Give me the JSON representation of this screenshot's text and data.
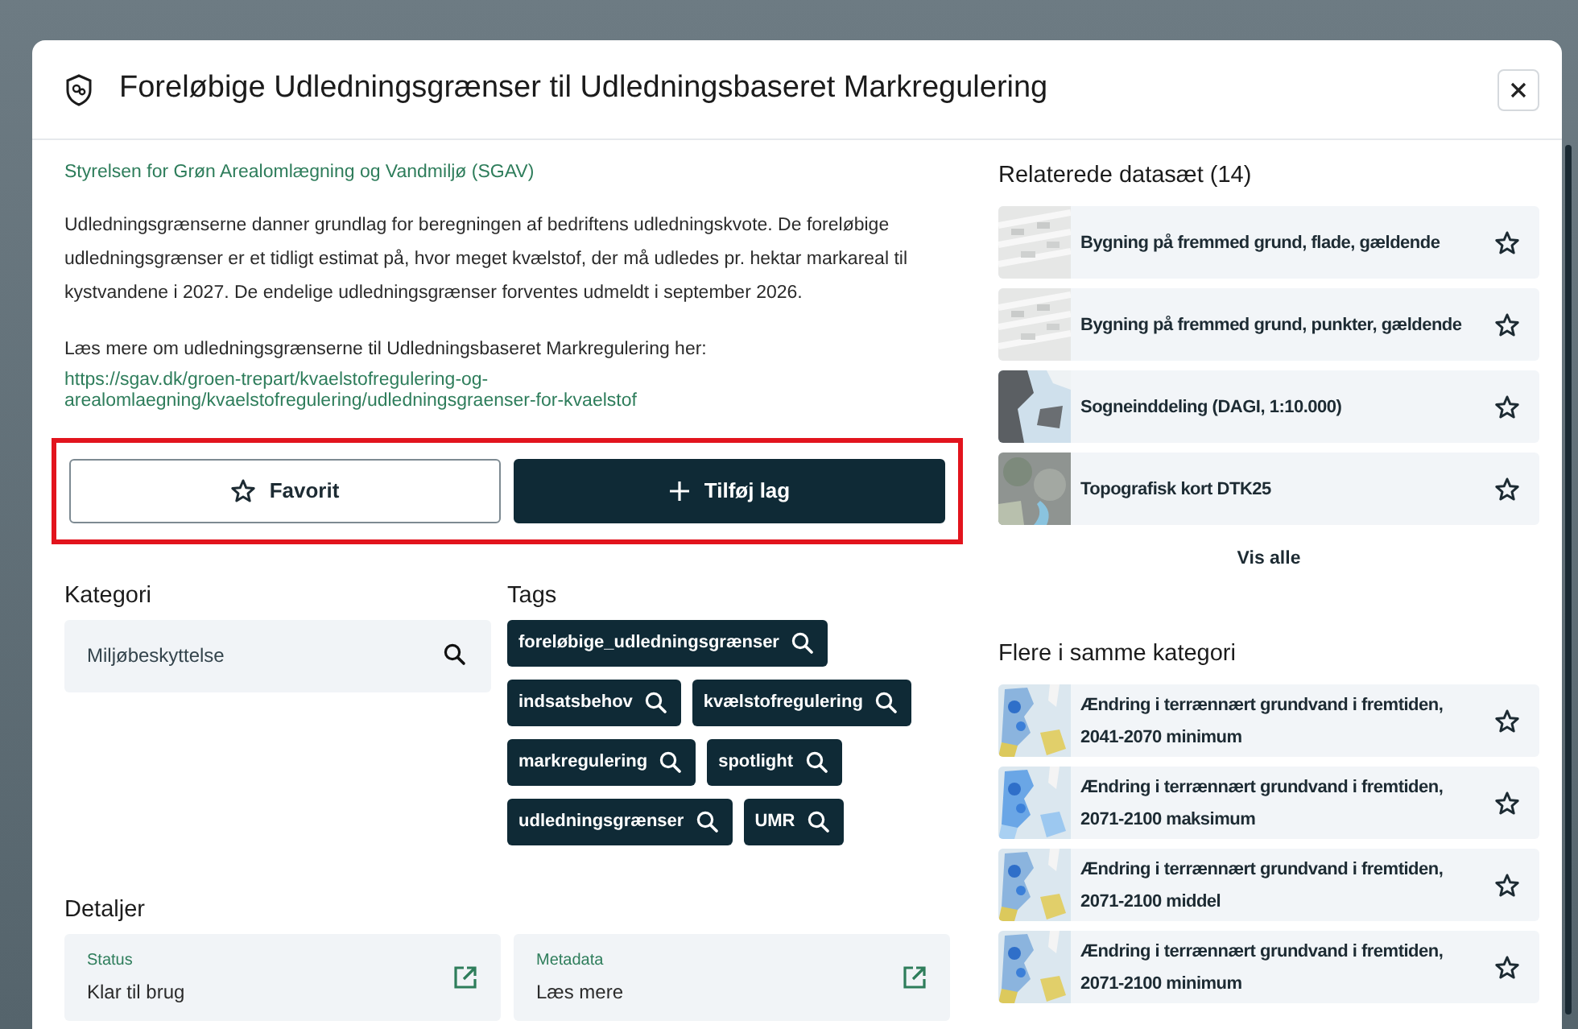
{
  "dialog": {
    "title": "Foreløbige Udledningsgrænser til Udledningsbaseret Markregulering"
  },
  "description": {
    "publisher": "Styrelsen for Grøn Arealomlægning og Vandmiljø (SGAV)",
    "paragraph": "Udledningsgrænserne danner grundlag for beregningen af bedriftens udledningskvote. De foreløbige udledningsgrænser er et tidligt estimat på, hvor meget kvælstof, der må udledes pr. hektar markareal til kystvandene i 2027. De endelige udledningsgrænser forventes udmeldt i september 2026.",
    "read_more": "Læs mere om udledningsgrænserne til Udledningsbaseret Markregulering her:",
    "link": "https://sgav.dk/groen-trepart/kvaelstofregulering-og-arealomlaegning/kvaelstofregulering/udledningsgraenser-for-kvaelstof"
  },
  "actions": [
    {
      "kind": "favorite",
      "label": "Favorit"
    },
    {
      "kind": "add",
      "label": "Tilføj lag"
    }
  ],
  "category": {
    "heading": "Kategori",
    "value": "Miljøbeskyttelse"
  },
  "tags": {
    "heading": "Tags",
    "items": [
      "foreløbige_udledningsgrænser",
      "indsatsbehov",
      "kvælstofregulering",
      "markregulering",
      "spotlight",
      "udledningsgrænser",
      "UMR"
    ]
  },
  "details": {
    "heading": "Detaljer",
    "items": [
      {
        "label": "Status",
        "value": "Klar til brug"
      },
      {
        "label": "Metadata",
        "value": "Læs mere"
      }
    ]
  },
  "related": {
    "heading": "Relaterede datasæt (14)",
    "items": [
      {
        "title": "Bygning på fremmed grund, flade, gældende"
      },
      {
        "title": "Bygning på fremmed grund, punkter, gældende"
      },
      {
        "title": "Sogneinddeling (DAGI, 1:10.000)"
      },
      {
        "title": "Topografisk kort DTK25"
      }
    ],
    "show_all": "Vis alle"
  },
  "same_category": {
    "heading": "Flere i samme kategori",
    "items": [
      {
        "title": "Ændring i terrænnært grundvand i fremtiden, 2041-2070 minimum"
      },
      {
        "title": "Ændring i terrænnært grundvand i fremtiden, 2071-2100 maksimum"
      },
      {
        "title": "Ændring i terrænnært grundvand i fremtiden, 2071-2100 middel"
      },
      {
        "title": "Ændring i terrænnært grundvand i fremtiden, 2071-2100 minimum"
      }
    ]
  }
}
